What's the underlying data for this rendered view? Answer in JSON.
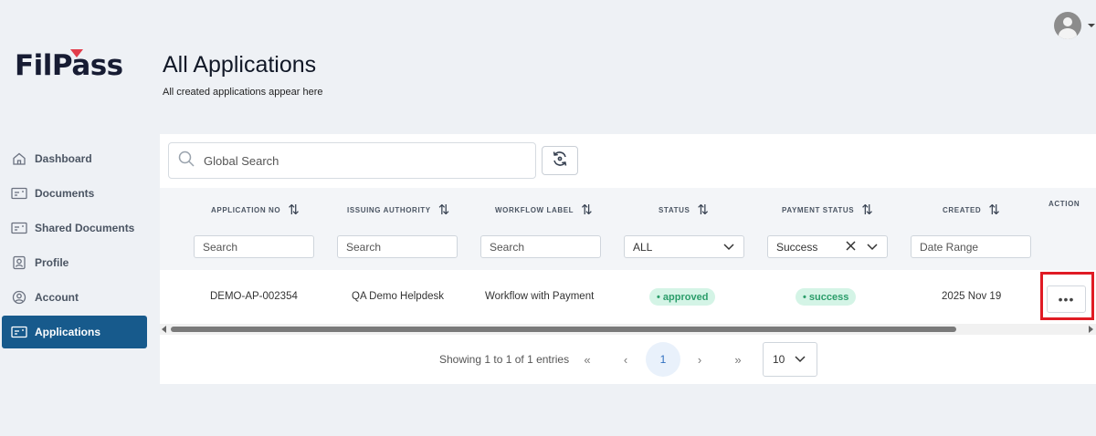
{
  "brand": {
    "logo_text": "FilPass"
  },
  "user": {
    "avatar_icon": "user-avatar-icon"
  },
  "page": {
    "title": "All Applications",
    "subtitle": "All created applications appear here"
  },
  "sidebar": {
    "items": [
      {
        "label": "Dashboard",
        "icon": "home-icon",
        "active": false
      },
      {
        "label": "Documents",
        "icon": "document-card-icon",
        "active": false
      },
      {
        "label": "Shared Documents",
        "icon": "shared-document-icon",
        "active": false
      },
      {
        "label": "Profile",
        "icon": "profile-icon",
        "active": false
      },
      {
        "label": "Account",
        "icon": "account-icon",
        "active": false
      },
      {
        "label": "Applications",
        "icon": "applications-icon",
        "active": true
      }
    ]
  },
  "search": {
    "placeholder": "Global Search"
  },
  "table": {
    "columns": [
      {
        "label": "APPLICATION NO",
        "sortable": true
      },
      {
        "label": "ISSUING AUTHORITY",
        "sortable": true
      },
      {
        "label": "WORKFLOW LABEL",
        "sortable": true
      },
      {
        "label": "STATUS",
        "sortable": true
      },
      {
        "label": "PAYMENT STATUS",
        "sortable": true
      },
      {
        "label": "CREATED",
        "sortable": true
      },
      {
        "label": "ACTION",
        "sortable": false
      }
    ],
    "sort_glyph": "⇅",
    "filters": {
      "application_no_placeholder": "Search",
      "issuing_authority_placeholder": "Search",
      "workflow_label_placeholder": "Search",
      "status_value": "ALL",
      "payment_status_value": "Success",
      "created_placeholder": "Date Range"
    },
    "rows": [
      {
        "application_no": "DEMO-AP-002354",
        "issuing_authority": "QA Demo Helpdesk",
        "workflow_label": "Workflow with Payment",
        "status": "• approved",
        "payment_status": "• success",
        "created": "2025 Nov 19",
        "action_label": "•••"
      }
    ]
  },
  "pagination": {
    "summary": "Showing 1 to 1 of 1 entries",
    "first": "«",
    "prev": "‹",
    "current_page": "1",
    "next": "›",
    "last": "»",
    "page_size": "10"
  },
  "colors": {
    "accent": "#175a8c",
    "badge_bg": "#d4f4e6",
    "badge_text": "#2b9d6a",
    "highlight": "#e01b24"
  }
}
